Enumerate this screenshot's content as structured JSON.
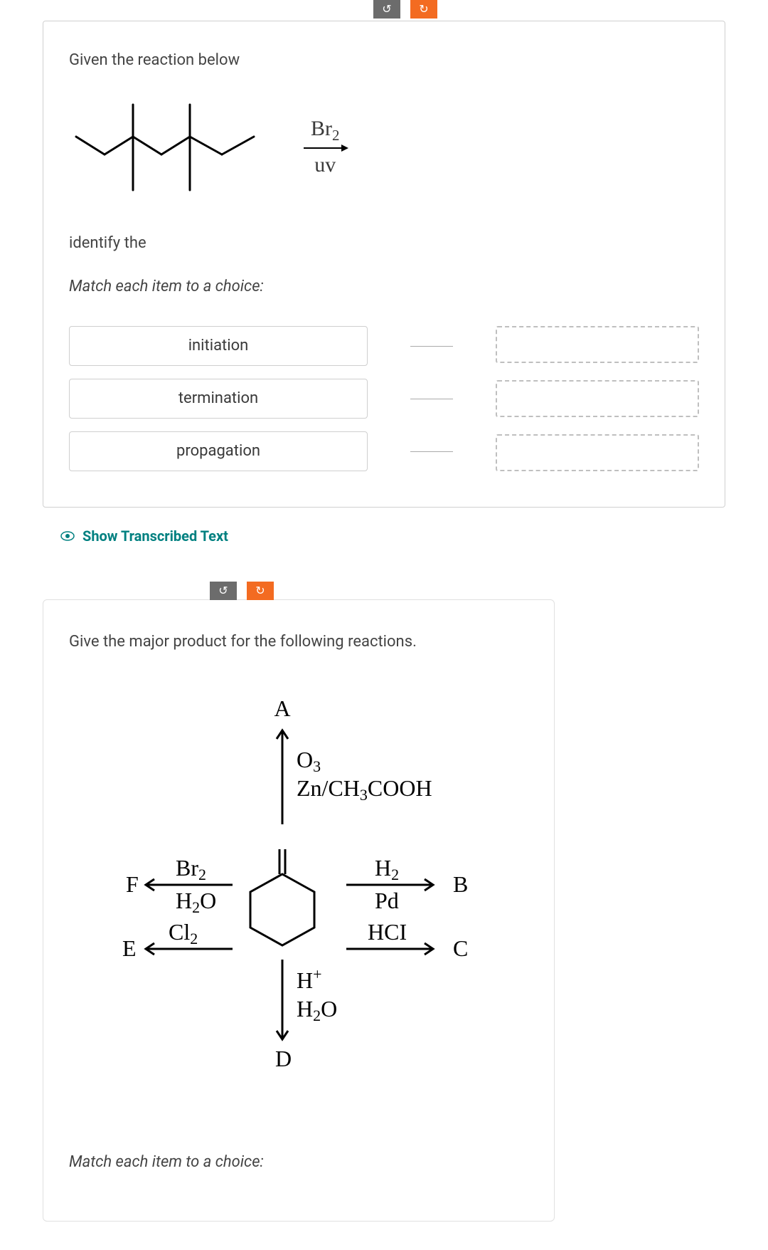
{
  "card1": {
    "prompt": "Given the reaction below",
    "reaction": {
      "reagent": "Br",
      "reagent_sub": "2",
      "condition": "uv"
    },
    "identify": "identify the",
    "match_instr": "Match each item to a choice:",
    "items": [
      "initiation",
      "termination",
      "propagation"
    ]
  },
  "show_transcribed": "Show Transcribed Text",
  "rot": {
    "ccw": "↺",
    "cw": "↻"
  },
  "card2": {
    "prompt": "Give the major product for the following reactions.",
    "labels": {
      "A": "A",
      "B": "B",
      "C": "C",
      "D": "D",
      "E": "E",
      "F": "F"
    },
    "reagents": {
      "top1": "O",
      "top1_sub": "3",
      "top2a": "Zn/CH",
      "top2_sub": "3",
      "top2b": "COOH",
      "right1": "H",
      "right1_sub": "2",
      "right1_below": "Pd",
      "right2": "HCI",
      "bottom1": "H",
      "bottom1_sup": "+",
      "bottom2": "H",
      "bottom2_sub": "2",
      "bottom2b": "O",
      "left1": "Br",
      "left1_sub": "2",
      "left1_below": "H",
      "left1_below_sub": "2",
      "left1_below_b": "O",
      "left2": "Cl",
      "left2_sub": "2"
    },
    "match_instr": "Match each item to a choice:"
  }
}
